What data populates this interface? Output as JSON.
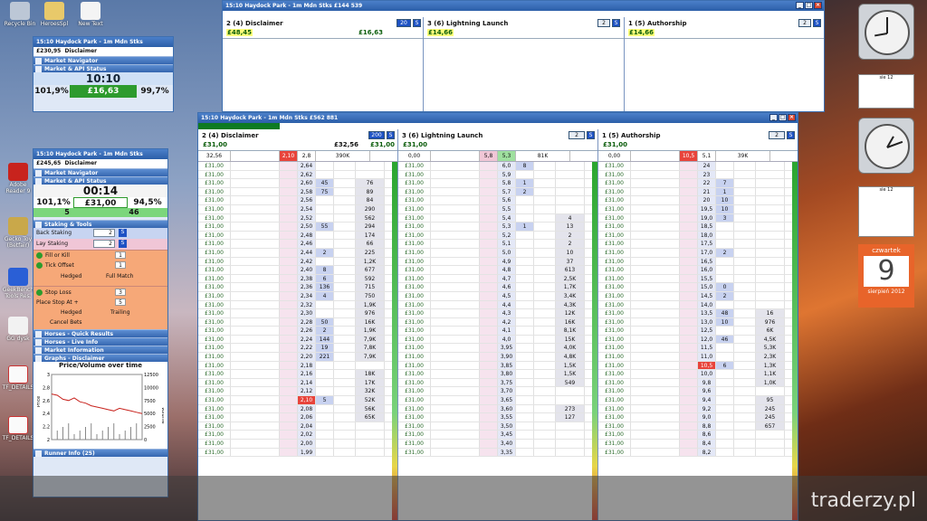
{
  "desktop": {
    "icons": [
      {
        "label": "Recycle Bin",
        "key": "recycle"
      },
      {
        "label": "HeroesSpl",
        "key": "folder"
      },
      {
        "label": "New Text",
        "key": "doc"
      },
      {
        "label": "Adobe Reader 9",
        "key": "adobe"
      },
      {
        "label": "Gecko Toy (Betfair)",
        "key": "gecko"
      },
      {
        "label": "GeekBench Tools Res.",
        "key": "tools"
      },
      {
        "label": "GG dysk",
        "key": "disk"
      },
      {
        "label": "TF_DETAILS",
        "key": "tf1"
      },
      {
        "label": "TF_DETAILS",
        "key": "tf2"
      }
    ],
    "watermark": "traderzy.pl"
  },
  "back_window": {
    "title": "15:10  Haydock Park - 1m Mdn Stks   £144 539",
    "runners": [
      {
        "name": "2  (4)  Disclaimer",
        "pl": "£48,45",
        "profit": "£16,63",
        "stake_box": "20",
        "stake_right": "£14,66"
      },
      {
        "name": "3  (6)  Lightning Launch",
        "pl": "£14,66",
        "stake_box": "2"
      },
      {
        "name": "1  (5)  Authorship",
        "pl": "£14,66",
        "stake_box": "2"
      }
    ]
  },
  "front_window": {
    "title": "15:10  Haydock Park - 1m Mdn Stks   £562 881",
    "runners": [
      {
        "name": "2  (4)  Disclaimer",
        "pl": "£31,00",
        "pl2": "£32,56",
        "stake_box": "200",
        "stake_right": "£31,00",
        "summary": [
          "32,56",
          "",
          "2,10",
          "2,8",
          "390K"
        ],
        "prices": [
          "2,64",
          "2,62",
          "2,60",
          "2,58",
          "2,56",
          "2,54",
          "2,52",
          "2,50",
          "2,48",
          "2,46",
          "2,44",
          "2,42",
          "2,40",
          "2,38",
          "2,36",
          "2,34",
          "2,32",
          "2,30",
          "2,28",
          "2,26",
          "2,24",
          "2,22",
          "2,20",
          "2,18",
          "2,16",
          "2,14",
          "2,12",
          "2,10",
          "2,08",
          "2,06",
          "2,04",
          "2,02",
          "2,00",
          "1,99"
        ],
        "backs": [
          "",
          "",
          "45",
          "75",
          "",
          "",
          "",
          "55",
          "",
          "",
          "2",
          "",
          "8",
          "6",
          "136",
          "4",
          "",
          "",
          "50",
          "2",
          "144",
          "19",
          "221",
          "",
          "",
          "",
          "",
          "5",
          "",
          "",
          "",
          "",
          "",
          ""
        ],
        "vols": [
          "",
          "",
          "76",
          "89",
          "84",
          "290",
          "562",
          "294",
          "174",
          "66",
          "225",
          "1,2K",
          "677",
          "592",
          "715",
          "750",
          "1,9K",
          "976",
          "16K",
          "1,9K",
          "7,9K",
          "7,8K",
          "7,9K",
          "",
          "18K",
          "17K",
          "32K",
          "52K",
          "56K",
          "65K",
          "",
          "",
          "",
          ""
        ]
      },
      {
        "name": "3  (6)  Lightning Launch",
        "pl": "£31,00",
        "stake_box": "2",
        "summary": [
          "0,00",
          "",
          "5,8",
          "5,3",
          "81K"
        ],
        "prices": [
          "6,0",
          "5,9",
          "5,8",
          "5,7",
          "5,6",
          "5,5",
          "5,4",
          "5,3",
          "5,2",
          "5,1",
          "5,0",
          "4,9",
          "4,8",
          "4,7",
          "4,6",
          "4,5",
          "4,4",
          "4,3",
          "4,2",
          "4,1",
          "4,0",
          "3,95",
          "3,90",
          "3,85",
          "3,80",
          "3,75",
          "3,70",
          "3,65",
          "3,60",
          "3,55",
          "3,50",
          "3,45",
          "3,40",
          "3,35"
        ],
        "backs": [
          "8",
          "",
          "1",
          "2",
          "",
          "",
          "",
          "1",
          "",
          "",
          "",
          "",
          "",
          "",
          "",
          "",
          "",
          "",
          "",
          "",
          "",
          "",
          "",
          "",
          "",
          "",
          "",
          "",
          "",
          "",
          "",
          "",
          "",
          ""
        ],
        "vols": [
          "",
          "",
          "",
          "",
          "",
          "",
          "4",
          "13",
          "2",
          "2",
          "10",
          "37",
          "613",
          "2,5K",
          "1,7K",
          "3,4K",
          "4,3K",
          "12K",
          "16K",
          "8,1K",
          "15K",
          "4,0K",
          "4,8K",
          "1,5K",
          "1,5K",
          "549",
          "",
          "",
          "273",
          "127",
          "",
          "",
          "",
          ""
        ]
      },
      {
        "name": "1  (5)  Authorship",
        "pl": "£31,00",
        "stake_box": "2",
        "summary": [
          "0,00",
          "",
          "10,5",
          "5,1",
          "39K"
        ],
        "prices": [
          "24",
          "23",
          "22",
          "21",
          "20",
          "19,5",
          "19,0",
          "18,5",
          "18,0",
          "17,5",
          "17,0",
          "16,5",
          "16,0",
          "15,5",
          "15,0",
          "14,5",
          "14,0",
          "13,5",
          "13,0",
          "12,5",
          "12,0",
          "11,5",
          "11,0",
          "10,5",
          "10,0",
          "9,8",
          "9,6",
          "9,4",
          "9,2",
          "9,0",
          "8,8",
          "8,6",
          "8,4",
          "8,2"
        ],
        "backs": [
          "",
          "",
          "7",
          "1",
          "10",
          "10",
          "3",
          "",
          "",
          "",
          "2",
          "",
          "",
          "",
          "0",
          "2",
          "",
          "48",
          "10",
          "",
          "46",
          "",
          "",
          "6",
          "",
          "",
          "",
          "",
          "",
          "",
          "",
          "",
          "",
          ""
        ],
        "vols": [
          "",
          "",
          "",
          "",
          "",
          "",
          "",
          "",
          "",
          "",
          "",
          "",
          "",
          "",
          "",
          "",
          "",
          "16",
          "976",
          "6K",
          "4,5K",
          "5,3K",
          "2,3K",
          "1,3K",
          "1,1K",
          "1,0K",
          "",
          "95",
          "245",
          "245",
          "657",
          "",
          "",
          ""
        ]
      }
    ]
  },
  "side_panels": [
    {
      "title": "15:10  Haydock Park - 1m Mdn Stks",
      "balance": "£230,95",
      "balance_label": "Disclaimer",
      "sections": [
        "Market Navigator",
        "Market & API Status"
      ],
      "time": "10:10",
      "left_pct": "101,9%",
      "mid": "£16,63",
      "right_pct": "99,7%"
    },
    {
      "title": "15:10  Haydock Park - 1m Mdn Stks",
      "balance": "£245,65",
      "balance_label": "Disclaimer",
      "sections": [
        "Market Navigator",
        "Market & API Status"
      ],
      "time": "00:14",
      "left_pct": "101,1%",
      "mid": "£31,00",
      "right_pct": "94,5%",
      "count_left": "5",
      "count_right": "46",
      "staking_title": "Staking & Tools",
      "back_label": "Back Staking",
      "back_val": "2",
      "lay_label": "Lay Staking",
      "lay_val": "2",
      "opt1": "Fill or Kill",
      "opt1_val": "1",
      "opt2": "Tick Offset",
      "opt2_val": "1",
      "hedge": "Hedged",
      "full_match": "Full Match",
      "stop_loss": "Stop Loss",
      "stop_val": "3",
      "place_stop": "Place Stop At +",
      "place_val": "5",
      "hedged2": "Hedged",
      "trailing": "Trailing",
      "cancel": "Cancel Bets",
      "more_sections": [
        "Horses - Quick Results",
        "Horses - Live Info",
        "Market Information",
        "Graphs - Disclaimer"
      ],
      "chart_title": "Price/Volume over time",
      "runner_info": "Runner Info (25)"
    }
  ],
  "chart_data": {
    "type": "line",
    "title": "Price/Volume over time",
    "ylabel": "Price",
    "y2label": "Volume",
    "y_ticks": [
      "3",
      "2,8",
      "2,6",
      "2,4",
      "2,2",
      "2"
    ],
    "y2_ticks": [
      "12500",
      "10000",
      "7500",
      "5000",
      "2500",
      "0"
    ],
    "series": [
      {
        "values": [
          2.7,
          2.68,
          2.62,
          2.6,
          2.64,
          2.58,
          2.56,
          2.52,
          2.5,
          2.48,
          2.46,
          2.44,
          2.48,
          2.46,
          2.44,
          2.42,
          2.4
        ]
      }
    ]
  },
  "clocks": [
    {
      "label": "clock-1"
    },
    {
      "label": "clock-2"
    }
  ],
  "calendar": {
    "month": "sie 12",
    "day_name": "czwartek",
    "day": "9",
    "month_year": "sierpień 2012"
  }
}
